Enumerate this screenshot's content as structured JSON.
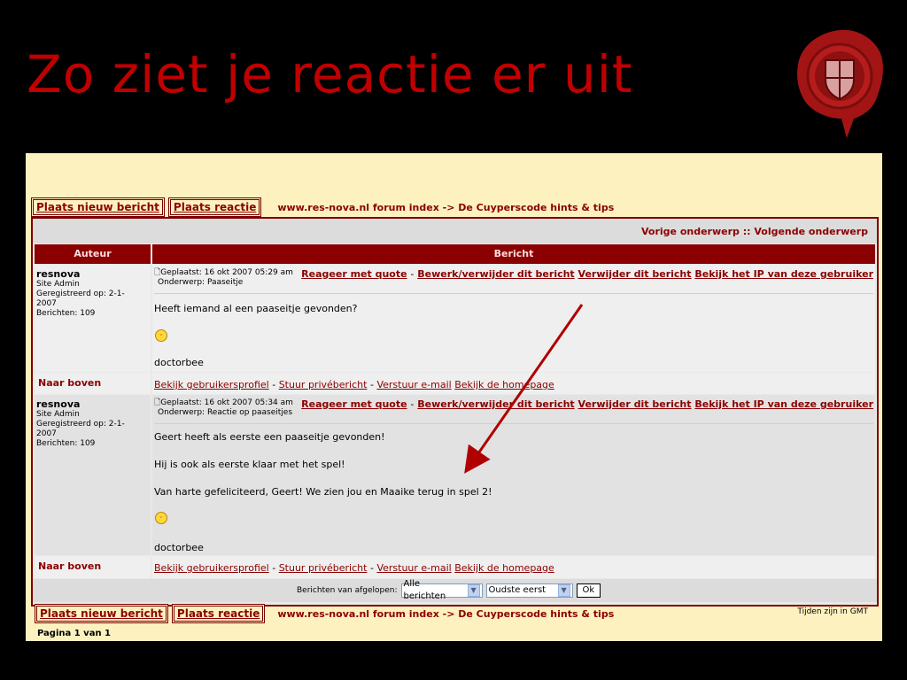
{
  "slide": {
    "title": "Zo ziet je reactie er uit"
  },
  "top": {
    "new_post": "Plaats nieuw bericht",
    "reply": "Plaats reactie",
    "breadcrumb": "www.res-nova.nl forum index -> De Cuyperscode hints & tips"
  },
  "forum": {
    "prev_next": "Vorige onderwerp :: Volgende onderwerp",
    "col_author": "Auteur",
    "col_message": "Bericht",
    "actions": {
      "quote": "Reageer met quote",
      "sep": "-",
      "edit": "Bewerk/verwijder dit bericht",
      "delete": "Verwijder dit bericht",
      "ip": "Bekijk het IP van deze gebruiker"
    },
    "posts": [
      {
        "author": "resnova",
        "rank": "Site Admin",
        "registered": "Geregistreerd op: 2-1-2007",
        "posts": "Berichten: 109",
        "posted": "Geplaatst: 16 okt 2007 05:29 am",
        "subject": "Onderwerp: Paaseitje",
        "lines": [
          "Heeft iemand al een paaseitje gevonden?"
        ],
        "signature": "doctorbee"
      },
      {
        "author": "resnova",
        "rank": "Site Admin",
        "registered": "Geregistreerd op: 2-1-2007",
        "posts": "Berichten: 109",
        "posted": "Geplaatst: 16 okt 2007 05:34 am",
        "subject": "Onderwerp: Reactie op paaseitjes",
        "lines": [
          "Geert heeft als eerste een paaseitje gevonden!",
          "Hij is ook als eerste klaar met het spel!",
          "Van harte gefeliciteerd, Geert! We zien jou en Maaike terug in spel 2!"
        ],
        "signature": "doctorbee"
      }
    ],
    "to_top": "Naar boven",
    "profile_links": {
      "profile": "Bekijk gebruikersprofiel",
      "pm": "Stuur privébericht",
      "email": "Verstuur e-mail",
      "homepage": "Bekijk de homepage"
    },
    "bottom": {
      "label": "Berichten van afgelopen:",
      "range": "Alle berichten",
      "order": "Oudste eerst",
      "ok": "Ok"
    }
  },
  "footer": {
    "new_post": "Plaats nieuw bericht",
    "reply": "Plaats reactie",
    "breadcrumb": "www.res-nova.nl forum index -> De Cuyperscode hints & tips",
    "timezone": "Tijden zijn in GMT",
    "pagination": "Pagina 1 van 1"
  },
  "colors": {
    "accent": "#8b0000",
    "title": "#c00000",
    "panel": "#fdf1c0"
  }
}
